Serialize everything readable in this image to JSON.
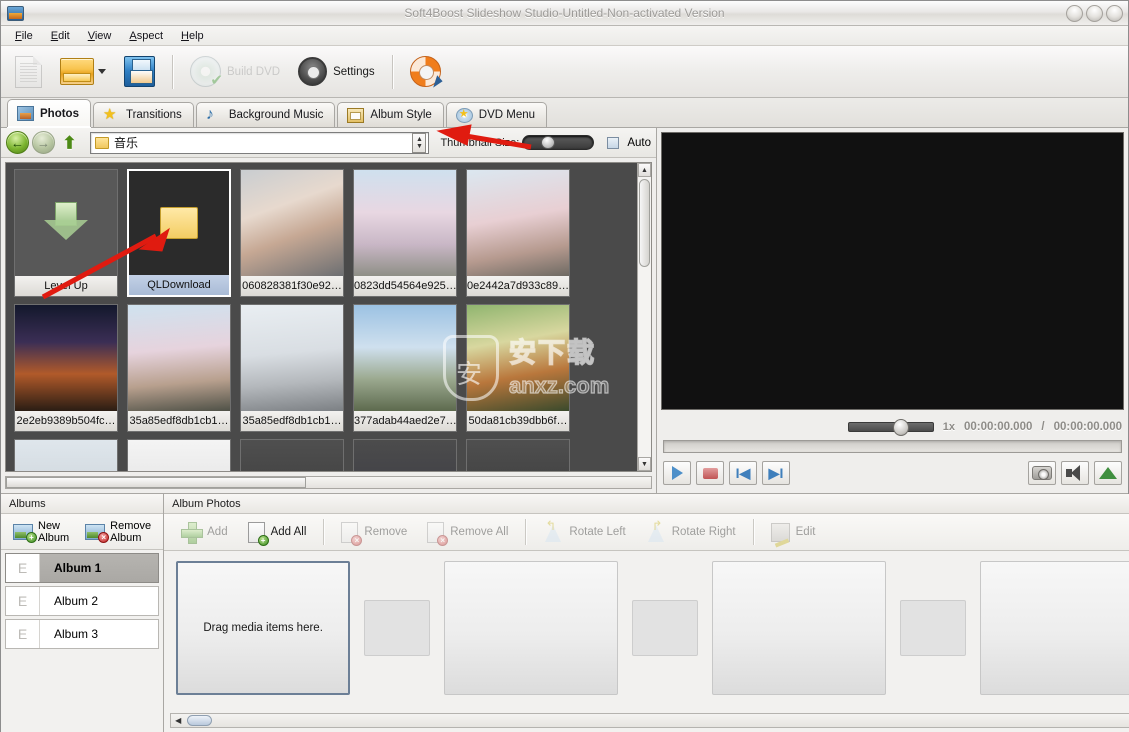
{
  "window": {
    "title": "Soft4Boost Slideshow Studio-Untitled-Non-activated Version",
    "app_icon": "app-icon",
    "buttons": [
      "minimize",
      "maximize",
      "close"
    ]
  },
  "menu": {
    "items": [
      {
        "label": "File"
      },
      {
        "label": "Edit"
      },
      {
        "label": "View"
      },
      {
        "label": "Aspect"
      },
      {
        "label": "Help"
      }
    ]
  },
  "toolbar": {
    "new_label": "",
    "open_label": "",
    "save_label": "",
    "build_dvd_label": "Build DVD",
    "settings_label": "Settings",
    "help_label": "",
    "icons": [
      "new-document-icon",
      "open-folder-icon",
      "dropdown-caret-icon",
      "save-floppy-icon",
      "dvd-disc-icon",
      "gear-icon",
      "lifebuoy-cursor-icon"
    ]
  },
  "tabs": [
    {
      "label": "Photos",
      "icon": "photos-icon",
      "active": true
    },
    {
      "label": "Transitions",
      "icon": "star-icon",
      "active": false
    },
    {
      "label": "Background Music",
      "icon": "music-note-icon",
      "active": false
    },
    {
      "label": "Album Style",
      "icon": "clipboard-icon",
      "active": false
    },
    {
      "label": "DVD Menu",
      "icon": "dvd-star-icon",
      "active": false
    }
  ],
  "browser": {
    "nav": {
      "back": "back-arrow-icon",
      "forward": "forward-arrow-icon",
      "up": "up-level-icon"
    },
    "path_value": "音乐",
    "path_folder_icon": "folder-icon",
    "spinner": "spinner-updown",
    "thumbnail_size_label": "Thumbnail Size:",
    "thumbnail_size_percent": 30,
    "auto_label": "Auto",
    "auto_checked": false,
    "items": [
      {
        "label": "Level Up",
        "kind": "levelup",
        "selected": false
      },
      {
        "label": "QLDownload",
        "kind": "folder",
        "selected": true
      },
      {
        "label": "060828381f30e92…",
        "kind": "image",
        "ph": "ph-1"
      },
      {
        "label": "0823dd54564e925…",
        "kind": "image",
        "ph": "ph-2"
      },
      {
        "label": "0e2442a7d933c89…",
        "kind": "image",
        "ph": "ph-3"
      },
      {
        "label": "2e2eb9389b504fc…",
        "kind": "image",
        "ph": "ph-4"
      },
      {
        "label": "35a85edf8db1cb1…",
        "kind": "image",
        "ph": "ph-5"
      },
      {
        "label": "35a85edf8db1cb1…",
        "kind": "image",
        "ph": "ph-6"
      },
      {
        "label": "377adab44aed2e7…",
        "kind": "image",
        "ph": "ph-7"
      },
      {
        "label": "50da81cb39dbb6f…",
        "kind": "image",
        "ph": "ph-8"
      },
      {
        "label": "",
        "kind": "image",
        "ph": "ph-9"
      },
      {
        "label": "",
        "kind": "image",
        "ph": "ph-10"
      },
      {
        "label": "",
        "kind": "image",
        "ph": "ph-11"
      },
      {
        "label": "",
        "kind": "image",
        "ph": "ph-12"
      },
      {
        "label": "",
        "kind": "image",
        "ph": "ph-13"
      }
    ]
  },
  "preview": {
    "speed_label": "1x",
    "speed_percent": 50,
    "time_current": "00:00:00.000",
    "time_separator": "/",
    "time_total": "00:00:00.000",
    "transport": [
      {
        "name": "play",
        "glyph": ""
      },
      {
        "name": "stop",
        "glyph": ""
      },
      {
        "name": "previous",
        "glyph": "I◀"
      },
      {
        "name": "next",
        "glyph": "▶I"
      }
    ],
    "snapshot_icon": "camera-snapshot-icon",
    "volume_icon": "speaker-icon",
    "volume_level_icon": "volume-level-icon"
  },
  "albums": {
    "panel_title": "Albums",
    "new_album_label": "New Album",
    "remove_album_label": "Remove Album",
    "items": [
      {
        "marker": "E",
        "label": "Album 1",
        "selected": true
      },
      {
        "marker": "E",
        "label": "Album 2",
        "selected": false
      },
      {
        "marker": "E",
        "label": "Album 3",
        "selected": false
      }
    ]
  },
  "album_photos": {
    "panel_title": "Album Photos",
    "tools": [
      {
        "label": "Add",
        "icon": "plus-icon",
        "disabled": true
      },
      {
        "label": "Add All",
        "icon": "add-all-icon",
        "disabled": false
      },
      {
        "label": "Remove",
        "icon": "remove-icon",
        "disabled": true
      },
      {
        "label": "Remove All",
        "icon": "remove-all-icon",
        "disabled": true
      },
      {
        "label": "Rotate Left",
        "icon": "rotate-left-icon",
        "disabled": true
      },
      {
        "label": "Rotate Right",
        "icon": "rotate-right-icon",
        "disabled": true
      },
      {
        "label": "Edit",
        "icon": "edit-icon",
        "disabled": true
      }
    ],
    "drop_hint": "Drag media items here.",
    "slot_count": 4
  },
  "watermark": {
    "chinese": "安下载",
    "english": "anxz.com"
  },
  "colors": {
    "accent_blue": "#4d8fc9",
    "stop_red": "#c05454",
    "selection_blue": "#a9bbd6",
    "annotation_red": "#e01b10",
    "folder_yellow": "#f3cd63"
  }
}
